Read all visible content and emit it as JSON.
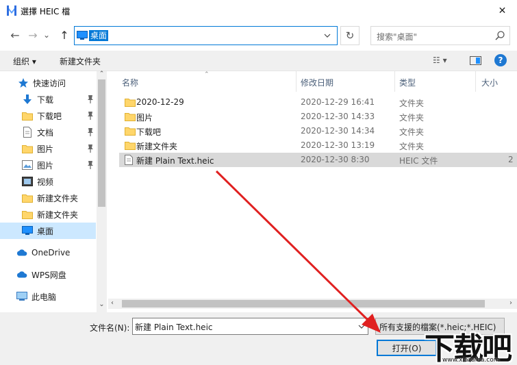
{
  "window": {
    "title": "選擇 HEIC 檔",
    "close_glyph": "✕"
  },
  "nav": {
    "back_icon": "←",
    "forward_icon": "→",
    "recent_icon": "⌄",
    "up_icon": "↑",
    "address": "桌面",
    "refresh_icon": "↻",
    "search_placeholder": "搜索\"桌面\""
  },
  "toolbar": {
    "organize": "组织 ▾",
    "new_folder": "新建文件夹",
    "view_icon": "☷ ▾",
    "help_icon": "?"
  },
  "navpane": {
    "items": [
      {
        "label": "快速访问",
        "icon": "star-icon",
        "pinned": false,
        "selected": false
      },
      {
        "label": "下载",
        "icon": "download-icon",
        "pinned": true,
        "selected": false
      },
      {
        "label": "下载吧",
        "icon": "folder-icon",
        "pinned": true,
        "selected": false
      },
      {
        "label": "文档",
        "icon": "document-icon",
        "pinned": true,
        "selected": false
      },
      {
        "label": "图片",
        "icon": "folder-icon",
        "pinned": true,
        "selected": false
      },
      {
        "label": "图片",
        "icon": "picture-icon",
        "pinned": true,
        "selected": false
      },
      {
        "label": "视频",
        "icon": "video-icon",
        "pinned": false,
        "selected": false
      },
      {
        "label": "新建文件夹",
        "icon": "folder-icon",
        "pinned": false,
        "selected": false
      },
      {
        "label": "新建文件夹",
        "icon": "folder-icon",
        "pinned": false,
        "selected": false
      },
      {
        "label": "桌面",
        "icon": "desktop-icon",
        "pinned": false,
        "selected": true
      },
      {
        "label": "OneDrive",
        "icon": "cloud-icon",
        "pinned": false,
        "selected": false
      },
      {
        "label": "WPS网盘",
        "icon": "cloud-icon",
        "pinned": false,
        "selected": false
      },
      {
        "label": "此电脑",
        "icon": "computer-icon",
        "pinned": false,
        "selected": false
      }
    ]
  },
  "filelist": {
    "columns": {
      "name": "名称",
      "modified": "修改日期",
      "type": "类型",
      "size": "大小"
    },
    "rows": [
      {
        "name": "2020-12-29",
        "modified": "2020-12-29 16:41",
        "type": "文件夹",
        "size": "",
        "icon": "folder-icon",
        "selected": false
      },
      {
        "name": "图片",
        "modified": "2020-12-30 14:33",
        "type": "文件夹",
        "size": "",
        "icon": "folder-icon",
        "selected": false
      },
      {
        "name": "下载吧",
        "modified": "2020-12-30 14:34",
        "type": "文件夹",
        "size": "",
        "icon": "folder-icon",
        "selected": false
      },
      {
        "name": "新建文件夹",
        "modified": "2020-12-30 13:19",
        "type": "文件夹",
        "size": "",
        "icon": "folder-icon",
        "selected": false
      },
      {
        "name": "新建 Plain Text.heic",
        "modified": "2020-12-30 8:30",
        "type": "HEIC 文件",
        "size": "2",
        "icon": "file-icon",
        "selected": true
      }
    ]
  },
  "bottom": {
    "filename_label": "文件名(N):",
    "filename_value": "新建 Plain Text.heic",
    "filetype_value": "所有支援的檔案(*.heic;*.HEIC)",
    "open_button": "打开(O)"
  },
  "watermark": {
    "text": "下载吧",
    "url": "www.xiazaiba.com"
  },
  "colors": {
    "accent": "#0078d7",
    "annotation_arrow": "#e02020",
    "folder": "#ffd66b"
  }
}
